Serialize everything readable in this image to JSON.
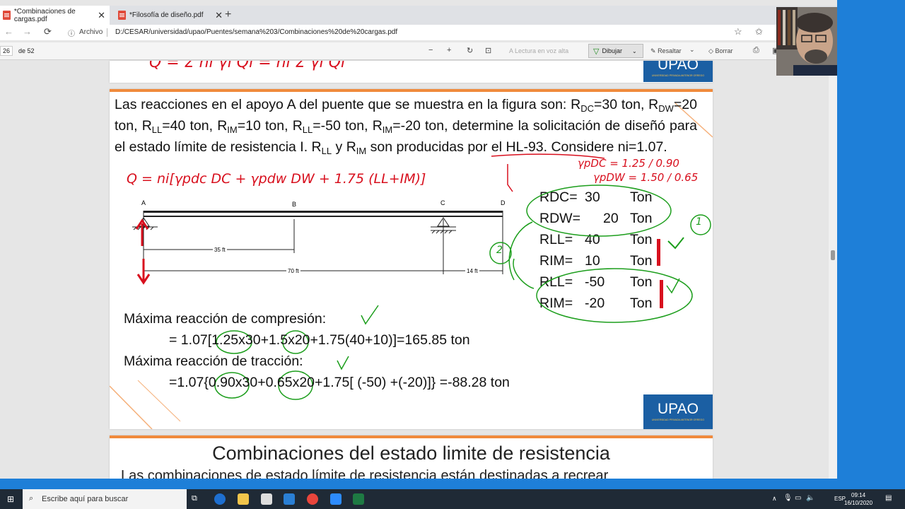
{
  "browser": {
    "tabs": [
      {
        "label": "*Combinaciones de cargas.pdf"
      },
      {
        "label": "*Filosofía de diseño.pdf"
      }
    ],
    "address_label": "Archivo",
    "url": "D:/CESAR/universidad/upao/Puentes/semana%203/Combinaciones%20de%20cargas.pdf"
  },
  "pdf_toolbar": {
    "page_current": "26",
    "page_total": "de 52",
    "read_aloud": "Lectura en voz alta",
    "draw": "Dibujar",
    "highlight": "Resaltar",
    "erase": "Borrar"
  },
  "slide_main": {
    "problem_parts": {
      "p1": "Las reacciones en el apoyo A del puente que se muestra en la figura son: R",
      "s1": "DC",
      "p2": "=30 ton, R",
      "s2": "DW",
      "p3": "=20 ton, R",
      "s3": "LL",
      "p4": "=40 ton, R",
      "s4": "IM",
      "p5": "=10 ton, R",
      "s5": "LL",
      "p6": "=-50 ton, R",
      "s6": "IM",
      "p7": "=-20 ton, determine la solicitación de diseñó para el estado límite de resistencia I. R",
      "s7": "LL",
      "p8": " y R",
      "s8": "IM",
      "p9": " son producidas por el HL-93. Considere ni=1.07."
    },
    "beam": {
      "labels": [
        "A",
        "B",
        "C",
        "D"
      ],
      "dims": [
        "35 ft",
        "70 ft",
        "14 ft"
      ]
    },
    "table": [
      {
        "key": "RDC=",
        "value": "30",
        "unit": "Ton"
      },
      {
        "key": "RDW=",
        "value": "20",
        "unit": "Ton"
      },
      {
        "key": "RLL=",
        "value": "40",
        "unit": "Ton"
      },
      {
        "key": "RIM=",
        "value": "10",
        "unit": "Ton"
      },
      {
        "key": "RLL=",
        "value": "-50",
        "unit": "Ton"
      },
      {
        "key": "RIM=",
        "value": "-20",
        "unit": "Ton"
      }
    ],
    "comp_title": "Máxima reacción de compresión:",
    "comp_formula": "= 1.07[1.25x30+1.5x20+1.75(40+10)]=165.85 ton",
    "trac_title": "Máxima reacción de tracción:",
    "trac_formula": "=1.07{0.90x30+0.65x20+1.75[ (-50) +(-20)]} =-88.28 ton",
    "annotations": {
      "formula": "Q = ni[γpdc DC + γpdw DW + 1.75 (LL+IM)]",
      "gdc": "γpDC = 1.25 / 0.90",
      "gdw": "γpDW = 1.50 / 0.65",
      "circle1": "1",
      "circle2": "2",
      "top_formula": "Q = Σ ni γi Qi = ni Σ γi Qi"
    },
    "logo": "UPAO",
    "logo_small": "UNIVERSIDAD PRIVADA ANTENOR ORREGO"
  },
  "slide_next": {
    "title": "Combinaciones del estado limite de resistencia",
    "subtitle": "Las combinaciones de estado límite de resistencia están destinadas a recrear"
  },
  "taskbar": {
    "search_placeholder": "Escribe aquí para buscar",
    "lang": "ESP",
    "time": "09:14",
    "date": "16/10/2020"
  },
  "colors": {
    "accent_orange": "#f08a3c",
    "upao_blue": "#1b5fa3",
    "ink_red": "#d8101e",
    "ink_green": "#1c9e1c"
  }
}
